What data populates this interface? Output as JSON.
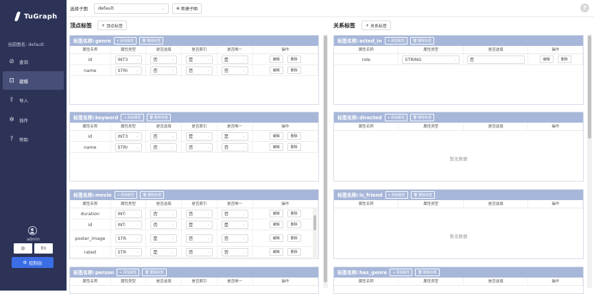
{
  "sidebar": {
    "logo": "TuGraph",
    "graph_label": "当前图名: default",
    "nav": [
      {
        "label": "查询",
        "icon": "compass-icon"
      },
      {
        "label": "建模",
        "icon": "schema-icon"
      },
      {
        "label": "导入",
        "icon": "import-icon"
      },
      {
        "label": "插件",
        "icon": "plugin-icon"
      },
      {
        "label": "帮助",
        "icon": "help-icon"
      }
    ],
    "active_nav": "建模",
    "user": "admin",
    "lang_zh": "中",
    "lang_en": "En",
    "console": "控制台"
  },
  "topbar": {
    "select_label": "选择子图",
    "select_value": "default",
    "new_subgraph": "新建子图",
    "help": "?"
  },
  "vertex_section": {
    "title": "顶点标签",
    "add": "顶点标签"
  },
  "edge_section": {
    "title": "关系标签",
    "add": "关系标签"
  },
  "card_common": {
    "label_prefix": "标签名称:",
    "add_attr": "添加属性",
    "delete_label": "删除标签",
    "edit": "编辑",
    "delete": "删除",
    "empty": "暂无数据"
  },
  "vertex_columns": [
    "属性名称",
    "属性类型",
    "是否选填",
    "是否索引",
    "是否唯一",
    "操作"
  ],
  "edge_columns": [
    "属性名称",
    "属性类型",
    "是否选填",
    "操作"
  ],
  "vertex_cards": [
    {
      "name": "genre",
      "rows": [
        [
          "id",
          "INT3",
          "否",
          "是",
          "是"
        ],
        [
          "name",
          "STRI",
          "否",
          "否",
          "否"
        ]
      ]
    },
    {
      "name": "keyword",
      "rows": [
        [
          "id",
          "INT3",
          "否",
          "是",
          "是"
        ],
        [
          "name",
          "STRI",
          "否",
          "否",
          "否"
        ]
      ]
    },
    {
      "name": "movie",
      "rows": [
        [
          "duration",
          "INT:",
          "否",
          "否",
          "否"
        ],
        [
          "id",
          "INT:",
          "否",
          "是",
          "是"
        ],
        [
          "poster_image",
          "STR",
          "是",
          "否",
          "否"
        ],
        [
          "rated",
          "STR",
          "是",
          "否",
          "否"
        ]
      ]
    },
    {
      "name": "person",
      "rows": []
    }
  ],
  "edge_cards": [
    {
      "name": "acted_in",
      "rows": [
        [
          "role",
          "STRING",
          "否"
        ]
      ]
    },
    {
      "name": "directed",
      "rows": []
    },
    {
      "name": "is_friend",
      "rows": []
    },
    {
      "name": "has_genre",
      "rows": []
    }
  ],
  "colors": {
    "sidebar": "#2c3357",
    "card_header": "#a7b7d9",
    "primary": "#3b6ee6"
  }
}
